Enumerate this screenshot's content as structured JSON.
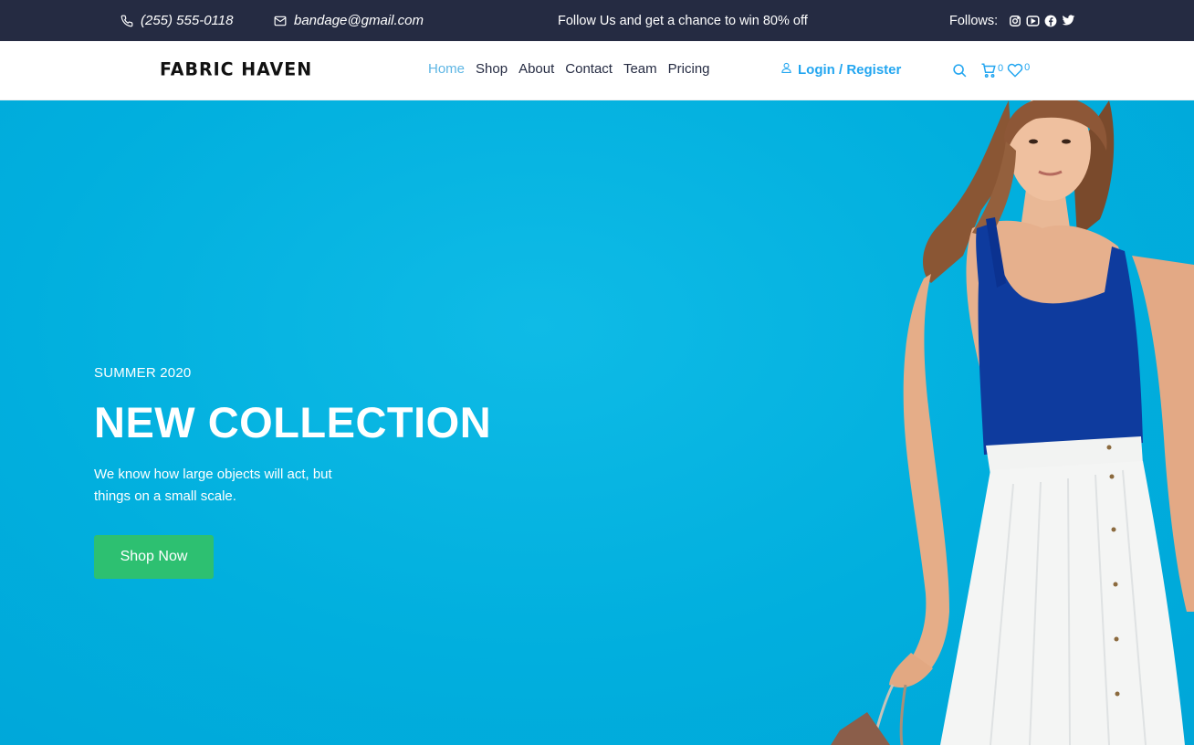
{
  "topbar": {
    "phone": "(255) 555-0118",
    "email": "bandage@gmail.com",
    "promo": "Follow Us  and get a chance to win 80% off",
    "follows_label": "Follows:",
    "social_icons": [
      "instagram-icon",
      "youtube-icon",
      "facebook-icon",
      "twitter-icon"
    ]
  },
  "nav": {
    "brand": "FABRIC HAVEN",
    "links": [
      "Home",
      "Shop",
      "About",
      "Contact",
      "Team",
      "Pricing"
    ],
    "active": "Home",
    "login_label": "Login / Register",
    "cart_count": "0",
    "wishlist_count": "0"
  },
  "hero": {
    "eyebrow": "SUMMER 2020",
    "headline": "NEW COLLECTION",
    "description": "We know how large objects will act, but things on a small scale.",
    "cta_label": "Shop Now"
  },
  "colors": {
    "topbar_bg": "#252b42",
    "hero_bg": "#00afde",
    "accent": "#23a6f0",
    "cta": "#2dc071"
  }
}
